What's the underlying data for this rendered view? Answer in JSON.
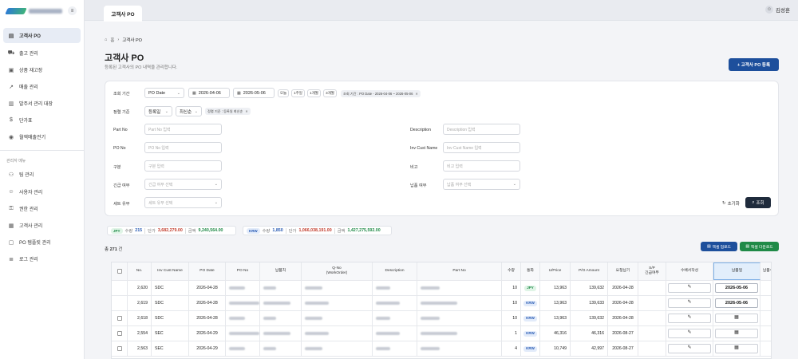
{
  "sidebar": {
    "menu_button": "≡",
    "items": [
      {
        "label": "고객사 PO",
        "icon": "document-icon"
      },
      {
        "label": "출고 관리",
        "icon": "truck-icon"
      },
      {
        "label": "상품 재고장",
        "icon": "box-icon"
      },
      {
        "label": "매출 관리",
        "icon": "chart-icon"
      },
      {
        "label": "발주서 관리 대장",
        "icon": "clipboard-icon"
      },
      {
        "label": "단가표",
        "icon": "dollar-icon"
      },
      {
        "label": "월액매출전기",
        "icon": "globe-icon"
      }
    ],
    "admin_heading": "관리자 메뉴",
    "admin_items": [
      {
        "label": "팀 관리",
        "icon": "team-icon"
      },
      {
        "label": "사용자 관리",
        "icon": "user-icon"
      },
      {
        "label": "권한 관리",
        "icon": "key-icon"
      },
      {
        "label": "고객사 관리",
        "icon": "building-icon"
      },
      {
        "label": "PO 템플릿 관리",
        "icon": "template-icon"
      },
      {
        "label": "로그 관리",
        "icon": "log-icon"
      }
    ]
  },
  "topbar": {
    "tab": "고객사 PO",
    "user": "김성훈"
  },
  "breadcrumb": {
    "home": "홈",
    "sep": "›",
    "current": "고객사 PO"
  },
  "page": {
    "title": "고객사 PO",
    "subtitle": "등록된 고객사의 PO 내역을 관리합니다.",
    "register_button": "+ 고객사 PO 등록"
  },
  "filters": {
    "period_label": "조회 기간",
    "period_type": "PO Date",
    "date_from": "2026-04-06",
    "date_to": "2026-05-06",
    "quick": [
      "오늘",
      "1주일",
      "1개월",
      "3개월"
    ],
    "period_chip": "조회 기간 : PO Date - 2026-04-06 ~ 2026-05-06",
    "sort_label": "정렬 기준",
    "sort_field": "등록일",
    "sort_order": "최신순",
    "sort_chip": "정렬 기준 : 등록일 최신순",
    "fields": [
      {
        "label": "Part No",
        "placeholder": "Part No 입력"
      },
      {
        "label": "PO No",
        "placeholder": "PO No 입력"
      },
      {
        "label": "구분",
        "placeholder": "구분 입력"
      },
      {
        "label": "긴급 여부",
        "placeholder": "긴급 여부 선택"
      },
      {
        "label": "세트 유무",
        "placeholder": "세트 유무 선택"
      },
      {
        "label": "Description",
        "placeholder": "Description 입력"
      },
      {
        "label": "Inv Cust Name",
        "placeholder": "Inv Cust Name 입력"
      },
      {
        "label": "비고",
        "placeholder": "비고 입력"
      },
      {
        "label": "납품 여부",
        "placeholder": "납품 여부 선택"
      }
    ],
    "reset": "초기화",
    "search": "조회"
  },
  "summary": [
    {
      "currency": "JPY",
      "qty_label": "수량",
      "qty": "215",
      "price_label": "단가",
      "price": "3,682,279.00",
      "amount_label": "금액",
      "amount": "9,240,564.00"
    },
    {
      "currency": "KRW",
      "qty_label": "수량",
      "qty": "1,850",
      "price_label": "단가",
      "price": "1,066,038,191.00",
      "amount_label": "금액",
      "amount": "1,427,275,592.00"
    }
  ],
  "total": {
    "prefix": "총",
    "count": "271",
    "suffix": "건"
  },
  "actions": {
    "upload": "엑셀 업로드",
    "download": "엑셀 다운로드"
  },
  "table": {
    "headers": [
      "",
      "No.",
      "Inv Cust Name",
      "PO Date",
      "PO No",
      "납품처",
      "Q-No\n(WorkOrder)",
      "Description",
      "Part No",
      "수량",
      "통화",
      "U/Price",
      "P/O Amount",
      "요청납기",
      "S/P\n긴급여부",
      "수배서작성",
      "납품일",
      "납품수"
    ],
    "rows": [
      {
        "no": "2,620",
        "cust": "SDC",
        "po_date": "2026-04-28",
        "qty": "10",
        "currency": "JPY",
        "uprice": "13,963",
        "amount": "139,632",
        "due": "2026-04-28",
        "delivery": "2026-05-06",
        "checkbox": false
      },
      {
        "no": "2,619",
        "cust": "SDC",
        "po_date": "2026-04-28",
        "qty": "10",
        "currency": "KRW",
        "uprice": "13,963",
        "amount": "139,633",
        "due": "2026-04-28",
        "delivery": "2026-05-06",
        "checkbox": false
      },
      {
        "no": "2,618",
        "cust": "SDC",
        "po_date": "2026-04-28",
        "qty": "10",
        "currency": "KRW",
        "uprice": "13,963",
        "amount": "139,632",
        "due": "2026-04-28",
        "delivery": "",
        "checkbox": true
      },
      {
        "no": "2,554",
        "cust": "SEC",
        "po_date": "2026-04-29",
        "qty": "1",
        "currency": "KRW",
        "uprice": "46,316",
        "amount": "46,316",
        "due": "2026-08-27",
        "delivery": "",
        "checkbox": true
      },
      {
        "no": "2,563",
        "cust": "SEC",
        "po_date": "2026-04-29",
        "qty": "4",
        "currency": "KRW",
        "uprice": "10,749",
        "amount": "42,997",
        "due": "2026-08-27",
        "delivery": "",
        "checkbox": true
      }
    ]
  },
  "colors": {
    "primary": "#1d4f9c",
    "success": "#1f8a47",
    "danger": "#c23b2b",
    "sidebar_active": "#e7ecf5"
  }
}
